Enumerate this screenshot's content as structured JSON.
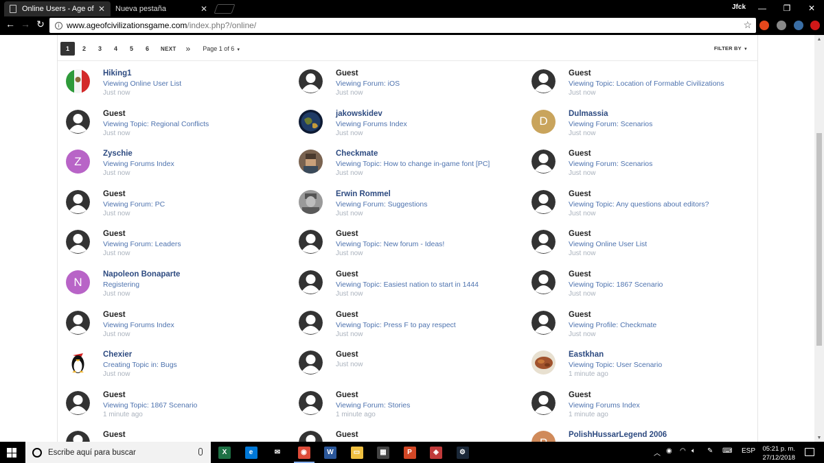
{
  "browser": {
    "tabs": [
      {
        "title": "Online Users - Age of Civ"
      },
      {
        "title": "Nueva pestaña"
      }
    ],
    "profile_name": "Jfck",
    "url_host": "www.ageofcivilizationsgame.com",
    "url_path": "/index.php?/online/"
  },
  "pagination": {
    "pages": [
      "1",
      "2",
      "3",
      "4",
      "5",
      "6"
    ],
    "active_page": "1",
    "next_label": "NEXT",
    "last_label": "»",
    "status": "Page 1 of 6",
    "filter_label": "FILTER BY"
  },
  "users": [
    {
      "name": "Hiking1",
      "activity": "Viewing Online User List",
      "time": "Just now",
      "avatar": "flag"
    },
    {
      "name": "Guest",
      "activity": "Viewing Forum: iOS",
      "time": "Just now",
      "avatar": "default"
    },
    {
      "name": "Guest",
      "activity": "Viewing Topic: Location of Formable Civilizations",
      "time": "Just now",
      "avatar": "default"
    },
    {
      "name": "Guest",
      "activity": "Viewing Topic: Regional Conflicts",
      "time": "Just now",
      "avatar": "default"
    },
    {
      "name": "jakowskidev",
      "activity": "Viewing Forums Index",
      "time": "Just now",
      "avatar": "globe"
    },
    {
      "name": "Dulmassia",
      "activity": "Viewing Forum: Scenarios",
      "time": "Just now",
      "avatar": "letter",
      "letter": "D",
      "color": "#c9a45c"
    },
    {
      "name": "Zyschie",
      "activity": "Viewing Forums Index",
      "time": "Just now",
      "avatar": "letter",
      "letter": "Z",
      "color": "#b864c7"
    },
    {
      "name": "Checkmate",
      "activity": "Viewing Topic: How to change in-game font [PC]",
      "time": "Just now",
      "avatar": "pixel"
    },
    {
      "name": "Guest",
      "activity": "Viewing Forum: Scenarios",
      "time": "Just now",
      "avatar": "default"
    },
    {
      "name": "Guest",
      "activity": "Viewing Forum: PC",
      "time": "Just now",
      "avatar": "default"
    },
    {
      "name": "Erwin Rommel",
      "activity": "Viewing Forum: Suggestions",
      "time": "Just now",
      "avatar": "photo"
    },
    {
      "name": "Guest",
      "activity": "Viewing Topic: Any questions about editors?",
      "time": "Just now",
      "avatar": "default"
    },
    {
      "name": "Guest",
      "activity": "Viewing Forum: Leaders",
      "time": "Just now",
      "avatar": "default"
    },
    {
      "name": "Guest",
      "activity": "Viewing Topic: New forum - Ideas!",
      "time": "Just now",
      "avatar": "default"
    },
    {
      "name": "Guest",
      "activity": "Viewing Online User List",
      "time": "Just now",
      "avatar": "default"
    },
    {
      "name": "Napoleon Bonaparte",
      "activity": "Registering",
      "time": "Just now",
      "avatar": "letter",
      "letter": "N",
      "color": "#b864c7"
    },
    {
      "name": "Guest",
      "activity": "Viewing Topic: Easiest nation to start in 1444",
      "time": "Just now",
      "avatar": "default"
    },
    {
      "name": "Guest",
      "activity": "Viewing Topic: 1867 Scenario",
      "time": "Just now",
      "avatar": "default"
    },
    {
      "name": "Guest",
      "activity": "Viewing Forums Index",
      "time": "Just now",
      "avatar": "default"
    },
    {
      "name": "Guest",
      "activity": "Viewing Topic: Press F to pay respect",
      "time": "Just now",
      "avatar": "default"
    },
    {
      "name": "Guest",
      "activity": "Viewing Profile: Checkmate",
      "time": "Just now",
      "avatar": "default"
    },
    {
      "name": "Chexier",
      "activity": "Creating Topic in: Bugs",
      "time": "Just now",
      "avatar": "penguin"
    },
    {
      "name": "Guest",
      "activity": "",
      "time": "Just now",
      "avatar": "default"
    },
    {
      "name": "Eastkhan",
      "activity": "Viewing Topic: User Scenario",
      "time": "1 minute ago",
      "avatar": "food"
    },
    {
      "name": "Guest",
      "activity": "Viewing Topic: 1867 Scenario",
      "time": "1 minute ago",
      "avatar": "default"
    },
    {
      "name": "Guest",
      "activity": "Viewing Forum: Stories",
      "time": "1 minute ago",
      "avatar": "default"
    },
    {
      "name": "Guest",
      "activity": "Viewing Forums Index",
      "time": "1 minute ago",
      "avatar": "default"
    },
    {
      "name": "Guest",
      "activity": "",
      "time": "",
      "avatar": "default"
    },
    {
      "name": "Guest",
      "activity": "",
      "time": "",
      "avatar": "default"
    },
    {
      "name": "PolishHussarLegend 2006",
      "activity": "",
      "time": "",
      "avatar": "letter",
      "letter": "P",
      "color": "#d08a5a"
    }
  ],
  "taskbar": {
    "search_placeholder": "Escribe aquí para buscar",
    "apps": [
      "excel",
      "edge",
      "mail",
      "chrome",
      "word",
      "file-explorer",
      "calculator",
      "powerpoint",
      "capture",
      "steam"
    ],
    "language": "ESP",
    "time": "05:21 p. m.",
    "date": "27/12/2018"
  }
}
